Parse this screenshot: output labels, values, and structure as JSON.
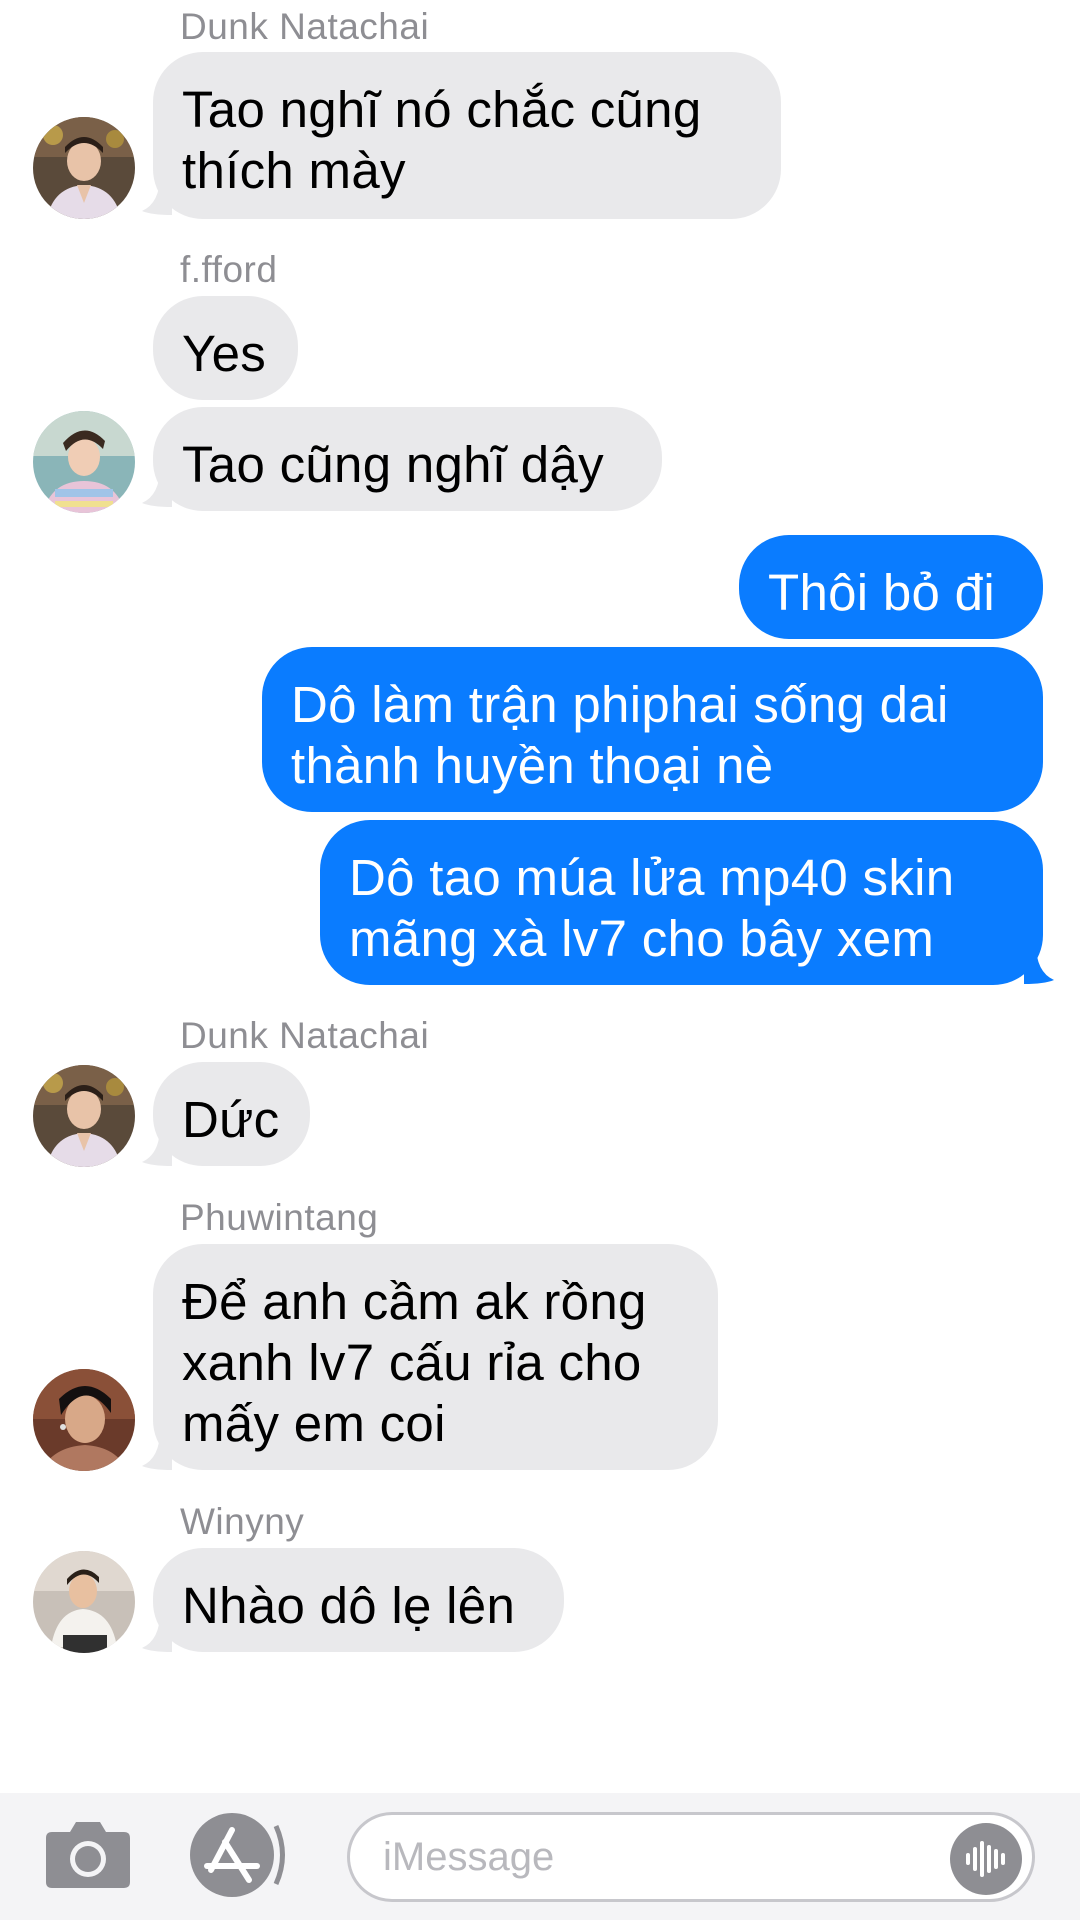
{
  "conversation": [
    {
      "type": "incoming",
      "sender": "Dunk Natachai",
      "text": "Tao nghĩ nó chắc cũng\nthích mày",
      "avatar": "avatar-dunk"
    },
    {
      "type": "incoming",
      "sender": "f.fford",
      "text": "Yes"
    },
    {
      "type": "incoming",
      "text": "Tao cũng nghĩ dậy",
      "avatar": "avatar-fford"
    },
    {
      "type": "outgoing",
      "text": "Thôi bỏ đi"
    },
    {
      "type": "outgoing",
      "text": "Dô làm trận phiphai sống dai\nthành huyền thoại nè"
    },
    {
      "type": "outgoing",
      "text": "Dô tao múa lửa mp40 skin\nmãng xà lv7 cho bây xem"
    },
    {
      "type": "incoming",
      "sender": "Dunk Natachai",
      "text": "Dức",
      "avatar": "avatar-dunk"
    },
    {
      "type": "incoming",
      "sender": "Phuwintang",
      "text": "Để anh cầm ak rồng\nxanh lv7 cấu rỉa cho\nmấy em coi",
      "avatar": "avatar-phuwin"
    },
    {
      "type": "incoming",
      "sender": "Winyny",
      "text": "Nhào dô lẹ lên",
      "avatar": "avatar-winyny"
    }
  ],
  "input_bar": {
    "camera_icon": "camera-icon",
    "appstore_icon": "app-store-icon",
    "placeholder": "iMessage",
    "audio_icon": "audio-waveform-icon"
  },
  "colors": {
    "incoming_bubble": "#e9e9eb",
    "outgoing_bubble": "#0a7cff",
    "sender_name": "#8e8e93"
  }
}
